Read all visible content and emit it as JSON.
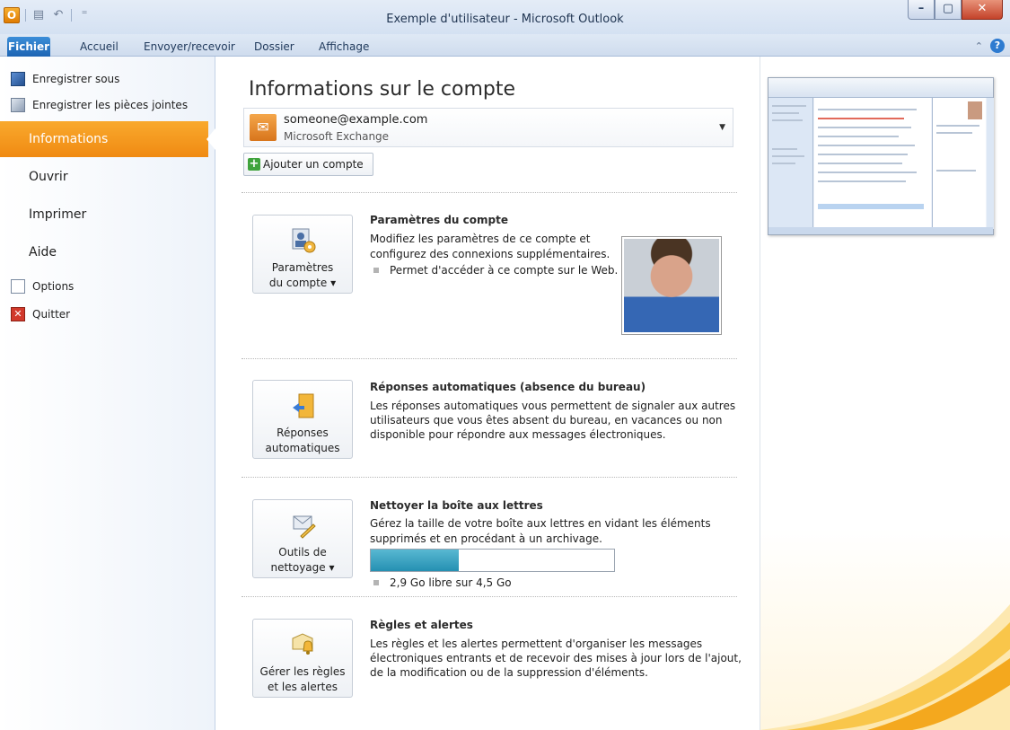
{
  "window": {
    "title": "Exemple d'utilisateur - Microsoft Outlook",
    "app_logo": "O"
  },
  "tabs": {
    "file": "Fichier",
    "items": [
      "Accueil",
      "Envoyer/recevoir",
      "Dossier",
      "Affichage"
    ],
    "help": "?"
  },
  "nav": {
    "save_as": "Enregistrer sous",
    "save_attachments": "Enregistrer les pièces jointes",
    "info": "Informations",
    "open": "Ouvrir",
    "print": "Imprimer",
    "help": "Aide",
    "options": "Options",
    "quit": "Quitter"
  },
  "main": {
    "title": "Informations sur le compte",
    "account": {
      "email": "someone@example.com",
      "type": "Microsoft Exchange"
    },
    "add_account": "Ajouter un compte",
    "account_settings": {
      "button_line1": "Paramètres",
      "button_line2": "du compte ▾",
      "title": "Paramètres du compte",
      "desc_line1": "Modifiez les paramètres de ce compte et",
      "desc_line2": "configurez des connexions supplémentaires.",
      "bullet": "Permet d'accéder à ce compte sur le Web."
    },
    "auto_replies": {
      "button_line1": "Réponses",
      "button_line2": "automatiques",
      "title": "Réponses automatiques (absence du bureau)",
      "desc_line1": "Les réponses automatiques vous permettent de signaler aux autres",
      "desc_line2": "utilisateurs que vous êtes absent du bureau, en vacances ou non",
      "desc_line3": "disponible pour répondre aux messages électroniques."
    },
    "cleanup": {
      "button_line1": "Outils de",
      "button_line2": "nettoyage ▾",
      "title": "Nettoyer la boîte aux lettres",
      "desc_line1": "Gérez la taille de votre boîte aux lettres en vidant les éléments",
      "desc_line2": "supprimés et en procédant à un archivage.",
      "storage_text": "2,9 Go libre sur 4,5 Go",
      "storage_used_fraction": 0.36
    },
    "rules": {
      "button_line1": "Gérer les règles",
      "button_line2": "et les alertes",
      "title": "Règles et alertes",
      "desc_line1": "Les règles et les alertes permettent d'organiser les messages",
      "desc_line2": "électroniques entrants et de recevoir des mises à jour lors de l'ajout,",
      "desc_line3": "de la modification ou de la suppression d'éléments."
    }
  },
  "colors": {
    "accent_orange": "#f08a12",
    "file_tab_blue": "#1d64b3",
    "storage_fill": "#2590b2"
  }
}
